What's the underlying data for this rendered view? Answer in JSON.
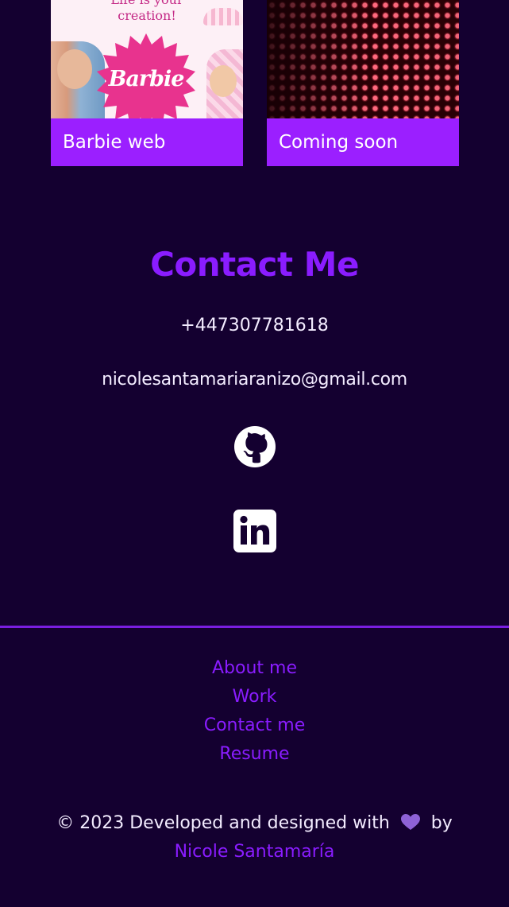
{
  "projects": [
    {
      "caption": "Barbie web",
      "thumb_tagline_line1": "Life is your",
      "thumb_tagline_line2": "creation!",
      "thumb_logo": "Barbie",
      "thumb_colors": {
        "background": "#fdf0f6",
        "burst": "#e8338e"
      }
    },
    {
      "caption": "Coming soon",
      "thumb_colors": {
        "background": "#2a0005",
        "light": "#ff6a7e"
      }
    }
  ],
  "contact": {
    "title": "Contact Me",
    "phone": "+447307781618",
    "email": "nicolesantamariaranizo@gmail.com",
    "icons": [
      "github-icon",
      "linkedin-icon"
    ]
  },
  "footer": {
    "nav": [
      "About me",
      "Work",
      "Contact me",
      "Resume"
    ],
    "copyright_prefix": "© 2023 Developed and designed with",
    "copyright_by": "by",
    "author": "Nicole Santamaría",
    "heart_icon": "purple-heart-icon"
  },
  "colors": {
    "background": "#140030",
    "accent": "#8a1cff",
    "caption_bg": "#9b1fff",
    "text": "#f3ecff",
    "divider": "#7a1ee0"
  }
}
